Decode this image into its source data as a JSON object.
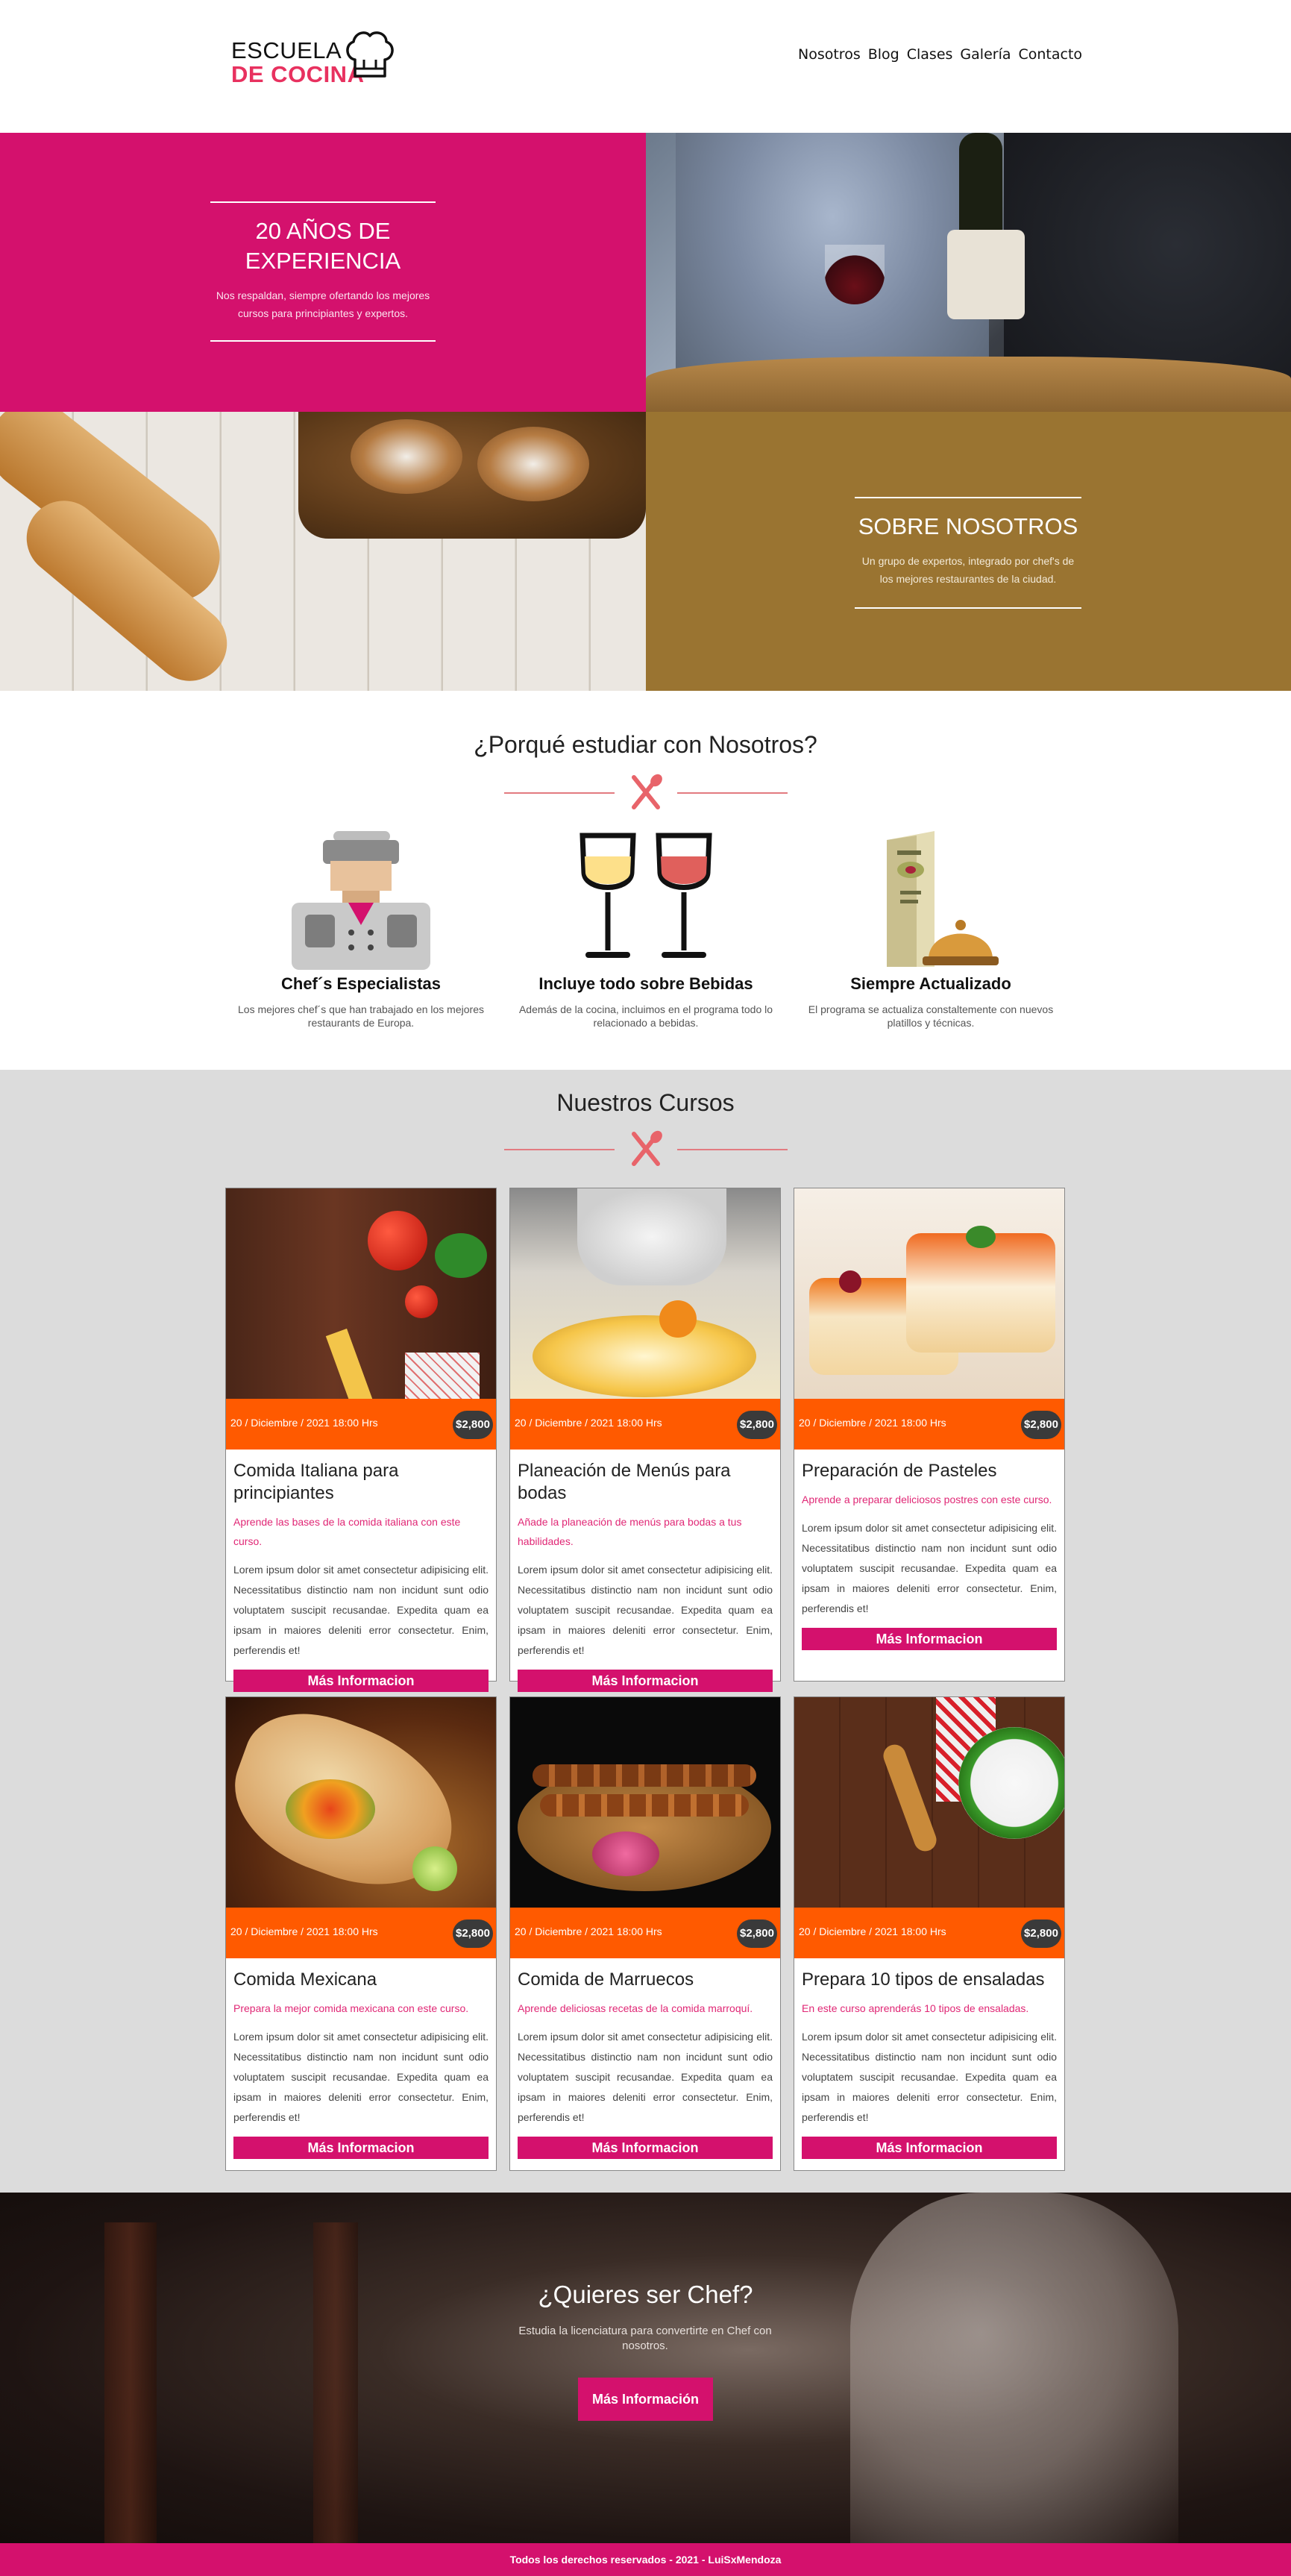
{
  "header": {
    "logo_line1": "ESCUELA",
    "logo_line2": "DE COCINA",
    "nav": [
      "Nosotros",
      "Blog",
      "Clases",
      "Galería",
      "Contacto"
    ]
  },
  "hero": {
    "experience_title": "20 AÑOS DE EXPERIENCIA",
    "experience_text": "Nos respaldan, siempre ofertando los mejores cursos para principiantes y expertos.",
    "about_title": "SOBRE NOSOTROS",
    "about_text": "Un grupo de expertos, integrado por chef's de los mejores restaurantes de la ciudad."
  },
  "why": {
    "title": "¿Porqué estudiar con Nosotros?",
    "features": [
      {
        "title": "Chef´s Especialistas",
        "text": "Los mejores chef´s que han trabajado en los mejores restaurants de Europa.",
        "icon": "chef-icon"
      },
      {
        "title": "Incluye todo sobre Bebidas",
        "text": "Además de la cocina, incluimos en el programa todo lo relacionado a bebidas.",
        "icon": "wine-glasses-icon"
      },
      {
        "title": "Siempre Actualizado",
        "text": "El programa se actualiza constaltemente con nuevos platillos y técnicas.",
        "icon": "menu-cloche-icon"
      }
    ]
  },
  "courses": {
    "title": "Nuestros Cursos",
    "button_label": "Más Informacion",
    "lorem": "Lorem ipsum dolor sit amet consectetur adipisicing elit. Necessitatibus distinctio nam non incidunt sunt odio voluptatem suscipit recusandae. Expedita quam ea ipsam in maiores deleniti error consectetur. Enim, perferendis et!",
    "items": [
      {
        "date": "20 / Diciembre / 2021 18:00 Hrs",
        "price": "$2,800",
        "title": "Comida Italiana para principiantes",
        "subtitle": "Aprende las bases de la comida italiana con este curso."
      },
      {
        "date": "20 / Diciembre / 2021 18:00 Hrs",
        "price": "$2,800",
        "title": "Planeación de Menús para bodas",
        "subtitle": "Añade la planeación de menús para bodas a tus habilidades."
      },
      {
        "date": "20 / Diciembre / 2021 18:00 Hrs",
        "price": "$2,800",
        "title": "Preparación de Pasteles",
        "subtitle": "Aprende a preparar deliciosos postres con este curso."
      },
      {
        "date": "20 / Diciembre / 2021 18:00 Hrs",
        "price": "$2,800",
        "title": "Comida Mexicana",
        "subtitle": "Prepara la mejor comida mexicana con este curso."
      },
      {
        "date": "20 / Diciembre / 2021 18:00 Hrs",
        "price": "$2,800",
        "title": "Comida de Marruecos",
        "subtitle": "Aprende deliciosas recetas de la comida marroquí."
      },
      {
        "date": "20 / Diciembre / 2021 18:00 Hrs",
        "price": "$2,800",
        "title": "Prepara 10 tipos de ensaladas",
        "subtitle": "En este curso aprenderás 10 tipos de ensaladas."
      }
    ]
  },
  "cta": {
    "title": "¿Quieres ser Chef?",
    "text": "Estudia la licenciatura para convertirte en Chef con nosotros.",
    "button": "Más Información"
  },
  "footer": {
    "text": "Todos los derechos reservados - 2021 - LuiSxMendoza"
  },
  "colors": {
    "primary": "#d4116d",
    "accent_orange": "#ff5a00",
    "brown": "#9a7431",
    "section_gray": "#dcdcdc"
  }
}
